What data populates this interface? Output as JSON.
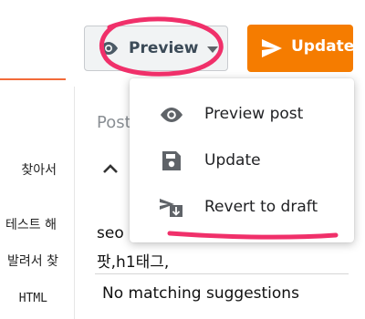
{
  "left_panel": {
    "lines": [
      "찾아서",
      "테스트 해",
      "발려서 찾",
      "HTML"
    ]
  },
  "toolbar": {
    "preview_label": "Preview",
    "update_label": "Update"
  },
  "editor": {
    "section_label": "Post",
    "text_line1": "seo",
    "text_line2": "팟,h1태그,",
    "suggestions_status": "No matching suggestions"
  },
  "dropdown": {
    "items": [
      {
        "label": "Preview post",
        "icon": "eye-icon"
      },
      {
        "label": "Update",
        "icon": "save-icon"
      },
      {
        "label": "Revert to draft",
        "icon": "revert-draft-icon"
      }
    ]
  },
  "colors": {
    "accent_orange": "#f57c00",
    "annotation_pink": "#f0306a",
    "icon_gray": "#5f6368"
  }
}
